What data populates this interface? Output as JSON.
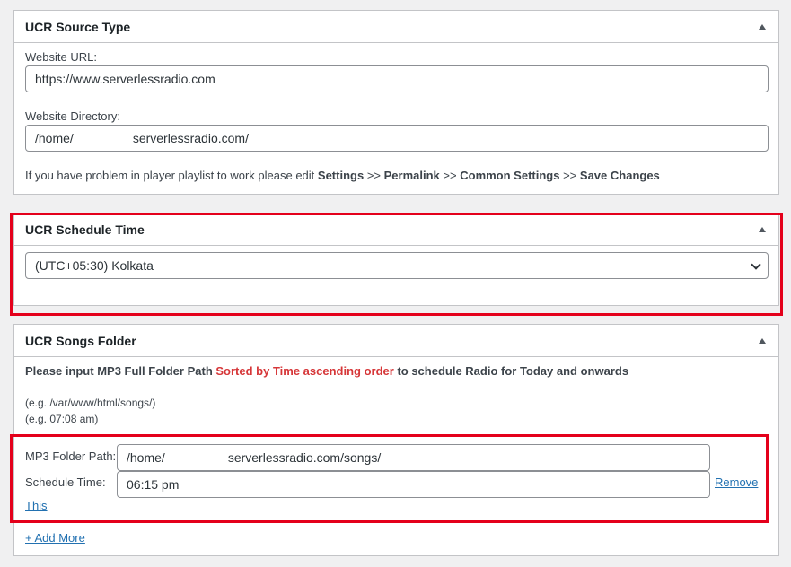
{
  "source_panel": {
    "title": "UCR Source Type",
    "website_url_label": "Website URL:",
    "website_url_value": "https://www.serverlessradio.com",
    "website_dir_label": "Website Directory:",
    "website_dir_prefix": "/home/",
    "website_dir_suffix": "serverlessradio.com/",
    "help_intro": "If you have problem in player playlist to work please edit",
    "help_steps": [
      "Settings",
      "Permalink",
      "Common Settings",
      "Save Changes"
    ],
    "help_sep": ">>"
  },
  "schedule_panel": {
    "title": "UCR Schedule Time",
    "timezone_value": "(UTC+05:30) Kolkata"
  },
  "songs_panel": {
    "title": "UCR Songs Folder",
    "instruction_pre": "Please input MP3 Full Folder Path",
    "instruction_red": "Sorted by Time ascending order",
    "instruction_post": "to schedule Radio for Today and onwards",
    "example_path": "(e.g. /var/www/html/songs/)",
    "example_time": "(e.g. 07:08 am)",
    "mp3_label": "MP3 Folder Path:",
    "mp3_prefix": "/home/",
    "mp3_suffix": "serverlessradio.com/songs/",
    "schedule_label": "Schedule Time:",
    "schedule_value": "06:15 pm",
    "remove_link_a": "Remove",
    "remove_link_b": "This",
    "add_more": "+ Add More"
  },
  "colors": {
    "highlight": "#e4001b",
    "link": "#2271b1",
    "red_text": "#d63638"
  }
}
